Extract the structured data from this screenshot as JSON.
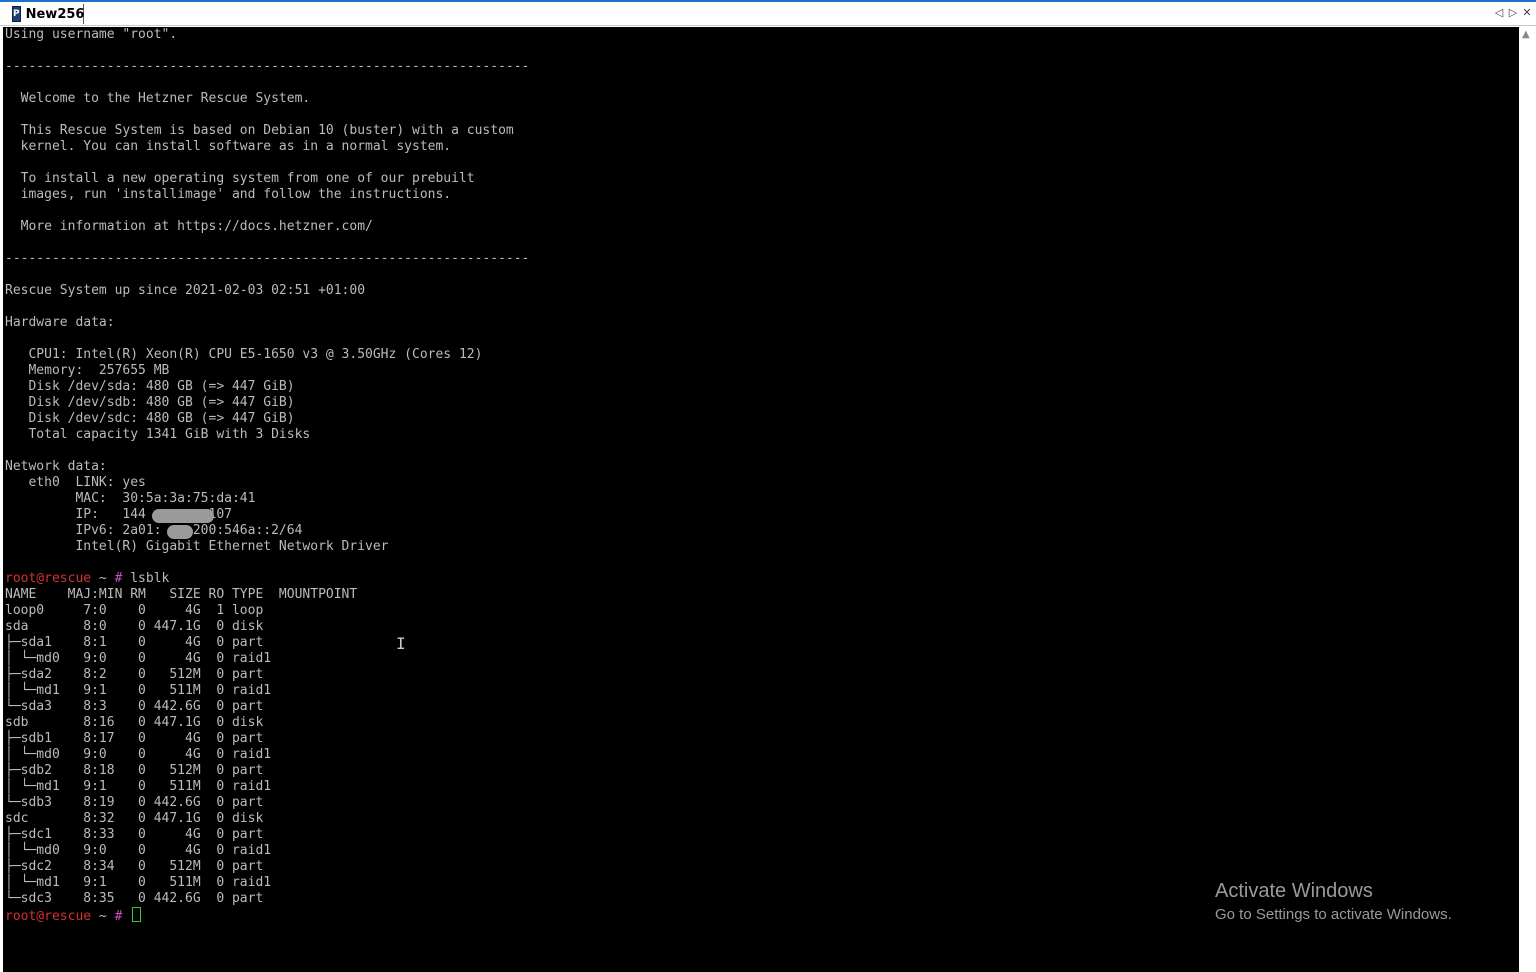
{
  "window": {
    "tab_title": "New256",
    "tab_icon_glyph": "P",
    "nav_prev": "◁",
    "nav_next": "▷",
    "close": "✕"
  },
  "terminal": {
    "colors": {
      "background": "#000000",
      "text": "#bbbbbb",
      "prompt_user": "#d23232",
      "prompt_hash": "#c850c8",
      "cursor": "#2ecc2e"
    },
    "lines": [
      "Using username \"root\".",
      "",
      "-------------------------------------------------------------------",
      "",
      "  Welcome to the Hetzner Rescue System.",
      "",
      "  This Rescue System is based on Debian 10 (buster) with a custom",
      "  kernel. You can install software as in a normal system.",
      "",
      "  To install a new operating system from one of our prebuilt",
      "  images, run 'installimage' and follow the instructions.",
      "",
      "  More information at https://docs.hetzner.com/",
      "",
      "-------------------------------------------------------------------",
      "",
      "Rescue System up since 2021-02-03 02:51 +01:00",
      "",
      "Hardware data:",
      "",
      "   CPU1: Intel(R) Xeon(R) CPU E5-1650 v3 @ 3.50GHz (Cores 12)",
      "   Memory:  257655 MB",
      "   Disk /dev/sda: 480 GB (=> 447 GiB)",
      "   Disk /dev/sdb: 480 GB (=> 447 GiB)",
      "   Disk /dev/sdc: 480 GB (=> 447 GiB)",
      "   Total capacity 1341 GiB with 3 Disks",
      "",
      "Network data:",
      "   eth0  LINK: yes",
      "         MAC:  30:5a:3a:75:da:41",
      "         IP:   144        107",
      "         IPv6: 2a01:   :200:546a::2/64",
      "         Intel(R) Gigabit Ethernet Network Driver",
      ""
    ],
    "prompt": {
      "user_host": "root@rescue",
      "path": " ~ ",
      "hash": "#",
      "command": " lsblk"
    },
    "lsblk": [
      "NAME    MAJ:MIN RM   SIZE RO TYPE  MOUNTPOINT",
      "loop0     7:0    0     4G  1 loop",
      "sda       8:0    0 447.1G  0 disk",
      "├─sda1    8:1    0     4G  0 part",
      "│ └─md0   9:0    0     4G  0 raid1",
      "├─sda2    8:2    0   512M  0 part",
      "│ └─md1   9:1    0   511M  0 raid1",
      "└─sda3    8:3    0 442.6G  0 part",
      "sdb       8:16   0 447.1G  0 disk",
      "├─sdb1    8:17   0     4G  0 part",
      "│ └─md0   9:0    0     4G  0 raid1",
      "├─sdb2    8:18   0   512M  0 part",
      "│ └─md1   9:1    0   511M  0 raid1",
      "└─sdb3    8:19   0 442.6G  0 part",
      "sdc       8:32   0 447.1G  0 disk",
      "├─sdc1    8:33   0     4G  0 part",
      "│ └─md0   9:0    0     4G  0 raid1",
      "├─sdc2    8:34   0   512M  0 part",
      "│ └─md1   9:1    0   511M  0 raid1",
      "└─sdc3    8:35   0 442.6G  0 part"
    ]
  },
  "watermark": {
    "title": "Activate Windows",
    "subtitle": "Go to Settings to activate Windows."
  },
  "icons": {
    "mouse_cursor": "ibeam-cursor-icon",
    "scroll_up": "▲"
  }
}
